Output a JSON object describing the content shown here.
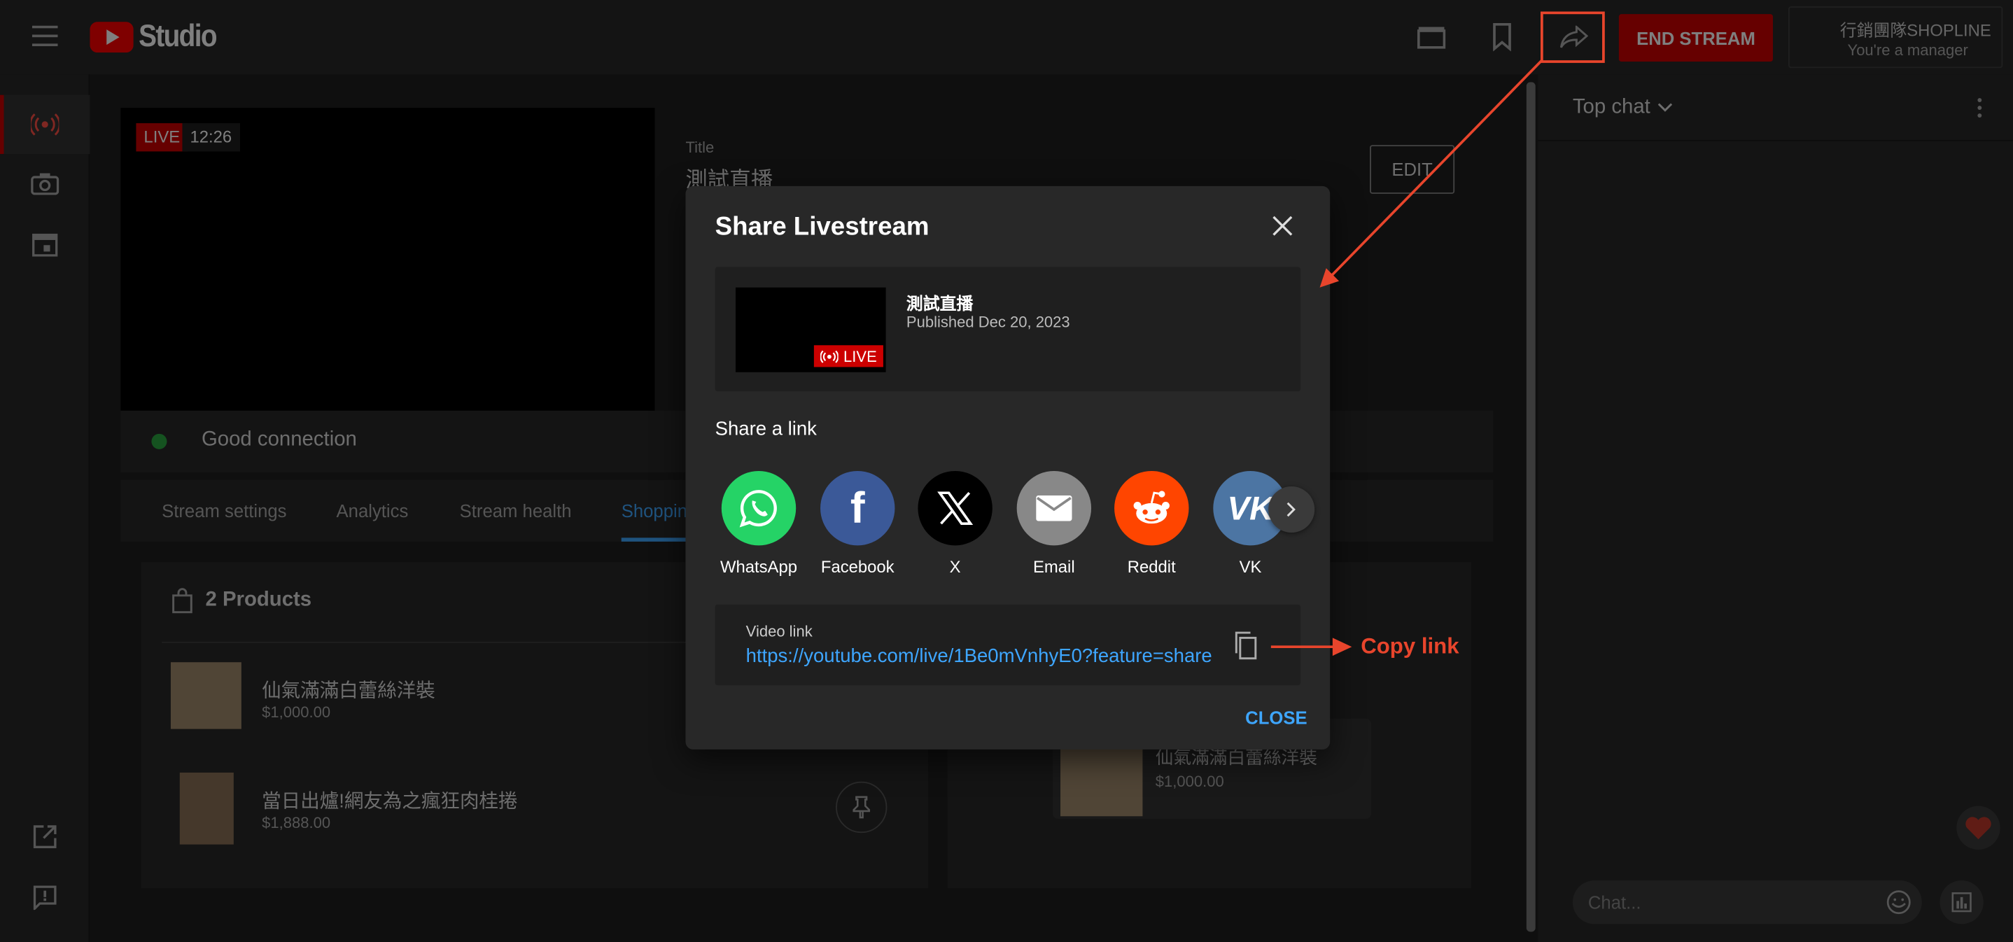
{
  "header": {
    "logo_text": "Studio",
    "end_stream_label": "END STREAM",
    "account_name": "行銷團隊SHOPLINE",
    "account_role": "You're a manager"
  },
  "player": {
    "live_badge": "LIVE",
    "elapsed": "12:26",
    "connection_status": "Good connection"
  },
  "details": {
    "title_label": "Title",
    "title_value": "測試直播",
    "edit_label": "EDIT"
  },
  "tabs": [
    "Stream settings",
    "Analytics",
    "Stream health",
    "Shopping"
  ],
  "products": {
    "count_label": "2 Products",
    "items": [
      {
        "name": "仙氣滿滿白蕾絲洋裝",
        "price": "$1,000.00"
      },
      {
        "name": "當日出爐!網友為之瘋狂肉桂捲",
        "price": "$1,888.00"
      }
    ],
    "pinned": {
      "name": "仙氣滿滿白蕾絲洋裝",
      "price": "$1,000.00"
    }
  },
  "chat": {
    "mode_label": "Top chat",
    "input_placeholder": "Chat..."
  },
  "modal": {
    "title": "Share Livestream",
    "video_title": "測試直播",
    "published": "Published Dec 20, 2023",
    "thumb_live": "LIVE",
    "share_heading": "Share a link",
    "share_targets": [
      {
        "label": "WhatsApp",
        "color": "#25d366"
      },
      {
        "label": "Facebook",
        "color": "#3b5998"
      },
      {
        "label": "X",
        "color": "#000000"
      },
      {
        "label": "Email",
        "color": "#888888"
      },
      {
        "label": "Reddit",
        "color": "#ff4500"
      },
      {
        "label": "VK",
        "color": "#4c75a3"
      }
    ],
    "link_label": "Video link",
    "link_url": "https://youtube.com/live/1Be0mVnhyE0?feature=share",
    "close_label": "CLOSE"
  },
  "annotation": {
    "copy_link": "Copy link",
    "color": "#e8452c"
  },
  "colors": {
    "brand_red": "#ff0000",
    "live_red": "#cc0000",
    "link_blue": "#3ea6ff",
    "status_green": "#2ba640"
  }
}
